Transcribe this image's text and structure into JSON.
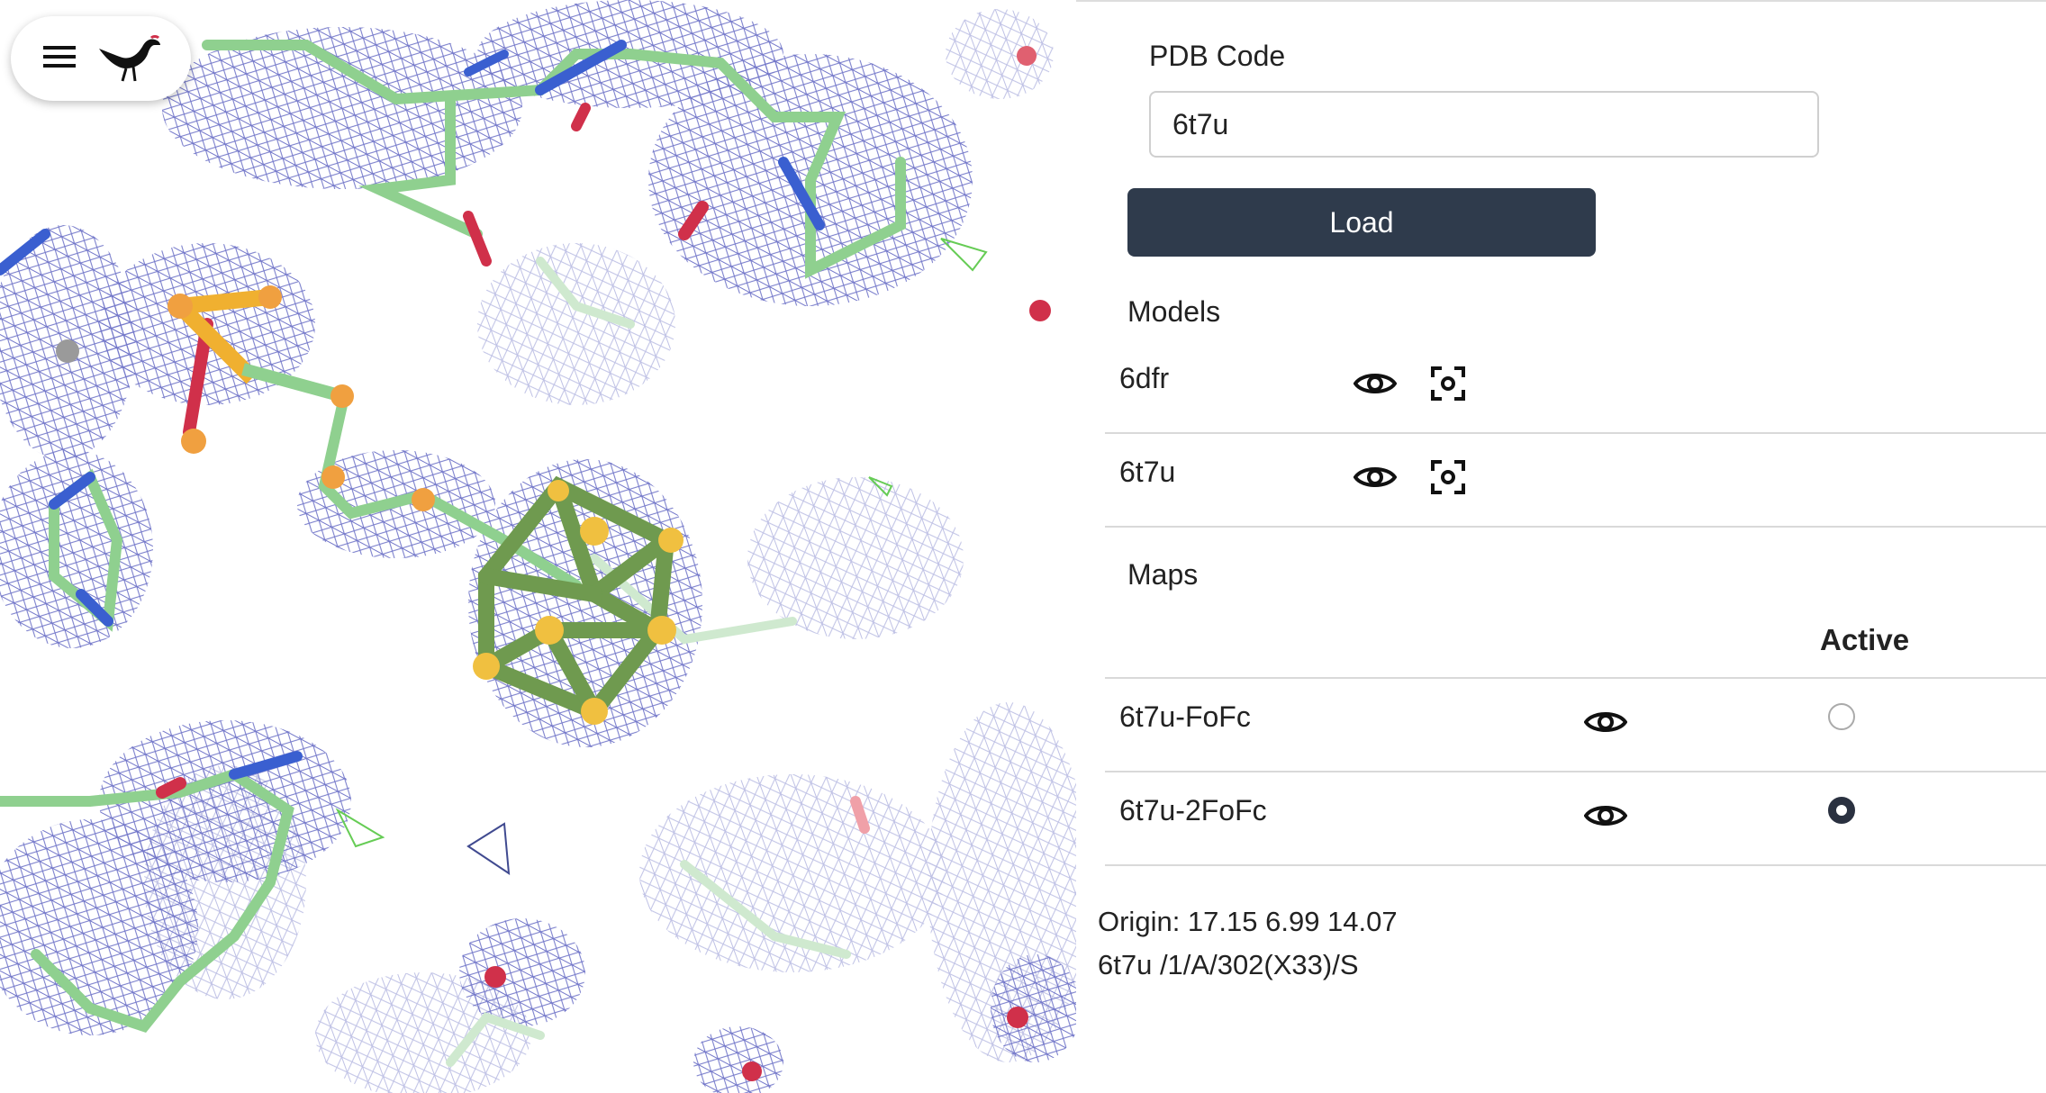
{
  "toolbar": {
    "menu_icon": "hamburger-menu-icon",
    "logo_icon": "bird-logo-icon"
  },
  "viewer": {
    "description_icon": "molecule-density-viewer"
  },
  "panel": {
    "pdb_code_label": "PDB Code",
    "pdb_code_value": "6t7u",
    "load_label": "Load",
    "models_heading": "Models",
    "models": [
      {
        "name": "6dfr",
        "icons": [
          "eye-icon",
          "focus-target-icon"
        ]
      },
      {
        "name": "6t7u",
        "icons": [
          "eye-icon",
          "focus-target-icon"
        ]
      }
    ],
    "maps_heading": "Maps",
    "maps_active_header": "Active",
    "maps": [
      {
        "name": "6t7u-FoFc",
        "active": false,
        "icon": "eye-icon"
      },
      {
        "name": "6t7u-2FoFc",
        "active": true,
        "icon": "eye-icon"
      }
    ],
    "origin_text": "Origin: 17.15 6.99 14.07",
    "selection_text": "6t7u /1/A/302(X33)/S"
  },
  "colors": {
    "button_bg": "#2f3b4c",
    "mesh": "#5a5fc0",
    "carbon": "#8fd08f",
    "nitrogen": "#3a5fd0",
    "oxygen": "#d0304a",
    "sulfur": "#f0b030"
  }
}
